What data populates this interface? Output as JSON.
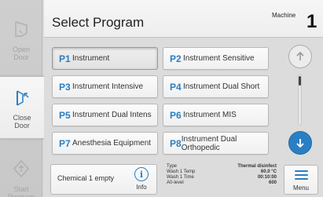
{
  "header": {
    "title": "Select Program",
    "machine_label": "Machine",
    "machine_number": "1"
  },
  "sidebar": {
    "open_door": "Open\nDoor",
    "close_door": "Close\nDoor",
    "start_program": "Start\nProgram"
  },
  "programs": [
    {
      "id": "P1",
      "name": "Instrument",
      "selected": true
    },
    {
      "id": "P2",
      "name": "Instrument Sensitive"
    },
    {
      "id": "P3",
      "name": "Instrument Intensive"
    },
    {
      "id": "P4",
      "name": "Instrument Dual Short"
    },
    {
      "id": "P5",
      "name": "Instrument Dual Intens"
    },
    {
      "id": "P6",
      "name": "Instrument MIS"
    },
    {
      "id": "P7",
      "name": "Anesthesia Equipment"
    },
    {
      "id": "P8",
      "name": "Instrument Dual Orthopedic"
    }
  ],
  "bottom": {
    "chemical_status": "Chemical 1 empty",
    "info_label": "Info",
    "menu_label": "Menu",
    "params": [
      {
        "key": "Type",
        "value": "Thermal disinfect"
      },
      {
        "key": "Wash 1 Temp",
        "value": "60.0 °C"
      },
      {
        "key": "Wash 1 Time",
        "value": "00:10:00"
      },
      {
        "key": "A0-level",
        "value": "600"
      }
    ]
  },
  "colors": {
    "accent": "#2a7fc4",
    "background": "#dcdcdc"
  },
  "icons": {
    "open_door": "open-door-icon",
    "close_door": "close-door-icon",
    "start_program": "start-program-icon",
    "scroll_up": "arrow-up-icon",
    "scroll_down": "arrow-down-icon",
    "info": "info-icon",
    "menu": "menu-icon"
  }
}
